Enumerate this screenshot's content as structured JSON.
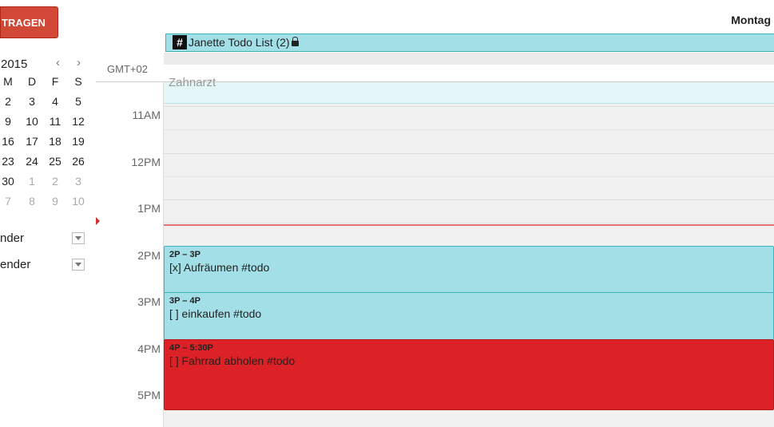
{
  "sidebar": {
    "create_label": "TRAGEN",
    "mini_calendar": {
      "year_label": "2015",
      "prev_label": "‹",
      "next_label": "›",
      "weekdays": [
        "M",
        "D",
        "F",
        "S"
      ],
      "weeks": [
        [
          {
            "d": "2"
          },
          {
            "d": "3"
          },
          {
            "d": "4"
          },
          {
            "d": "5"
          }
        ],
        [
          {
            "d": "9"
          },
          {
            "d": "10"
          },
          {
            "d": "11"
          },
          {
            "d": "12"
          }
        ],
        [
          {
            "d": "16"
          },
          {
            "d": "17"
          },
          {
            "d": "18"
          },
          {
            "d": "19"
          }
        ],
        [
          {
            "d": "23"
          },
          {
            "d": "24"
          },
          {
            "d": "25"
          },
          {
            "d": "26"
          }
        ],
        [
          {
            "d": "30"
          },
          {
            "d": "1",
            "muted": true
          },
          {
            "d": "2",
            "muted": true
          },
          {
            "d": "3",
            "muted": true
          }
        ],
        [
          {
            "d": "7",
            "muted": true
          },
          {
            "d": "8",
            "muted": true
          },
          {
            "d": "9",
            "muted": true
          },
          {
            "d": "10",
            "muted": true
          }
        ]
      ]
    },
    "calendars": [
      {
        "label": "nder"
      },
      {
        "label": "ender"
      }
    ]
  },
  "header": {
    "day_label": "Montag"
  },
  "allday": {
    "hash_icon": "#",
    "title": "Janette Todo List (2)",
    "lock_icon": "lock-icon"
  },
  "timezone": "GMT+02",
  "ghost_event": "Zahnarzt",
  "hour_labels": [
    "11AM",
    "12PM",
    "1PM",
    "2PM",
    "3PM",
    "4PM",
    "5PM"
  ],
  "events": [
    {
      "time": "2P – 3P",
      "name": "[x] Aufräumen #todo",
      "color": "#a2dfe7",
      "start": 14,
      "end": 15
    },
    {
      "time": "3P – 4P",
      "name": "[ ] einkaufen #todo",
      "color": "#a2dfe7",
      "start": 15,
      "end": 16
    },
    {
      "time": "4P – 5:30P",
      "name": "[ ] Fahrrad abholen #todo",
      "color": "#dc2127",
      "start": 16,
      "end": 17.5
    }
  ],
  "current_time_hour": 13.53,
  "colors": {
    "create_button": "#d14836",
    "event_teal": "#a2dfe7",
    "event_red": "#dc2127",
    "now_line": "#e57373"
  }
}
